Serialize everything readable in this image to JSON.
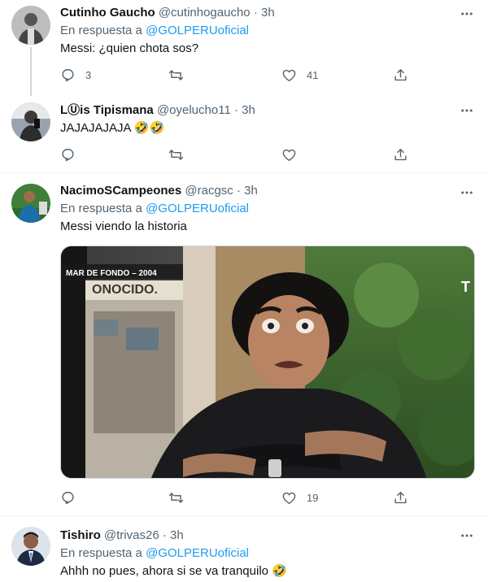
{
  "tweets": [
    {
      "name": "Cutinho Gaucho",
      "handle": "@cutinhogaucho",
      "sep": "·",
      "time": "3h",
      "reply_prefix": "En respuesta a",
      "reply_to": "@GOLPERUoficial",
      "text": "Messi: ¿quien chota sos?",
      "replies": "3",
      "retweets": "",
      "likes": "41"
    },
    {
      "name": "LⓊis Tipismana",
      "handle": "@oyelucho11",
      "sep": "·",
      "time": "3h",
      "text": "JAJAJAJAJA 🤣🤣",
      "replies": "",
      "retweets": "",
      "likes": ""
    },
    {
      "name": "NacimoSCampeones",
      "handle": "@racgsc",
      "sep": "·",
      "time": "3h",
      "reply_prefix": "En respuesta a",
      "reply_to": "@GOLPERUoficial",
      "text": "Messi viendo la historia",
      "media_banner": "MAR DE FONDO – 2004",
      "media_sign": "ONOCIDO.",
      "media_logo": "T",
      "replies": "",
      "retweets": "",
      "likes": "19"
    },
    {
      "name": "Tishiro",
      "handle": "@trivas26",
      "sep": "·",
      "time": "3h",
      "reply_prefix": "En respuesta a",
      "reply_to": "@GOLPERUoficial",
      "text": "Ahhh no pues, ahora si se va tranquilo 🤣"
    }
  ],
  "icons": {
    "reply": "reply-icon",
    "retweet": "retweet-icon",
    "like": "like-icon",
    "share": "share-icon",
    "more": "more-icon"
  },
  "colors": {
    "link": "#1d9bf0",
    "secondary_text": "#536471",
    "divider": "#eff3f4"
  }
}
